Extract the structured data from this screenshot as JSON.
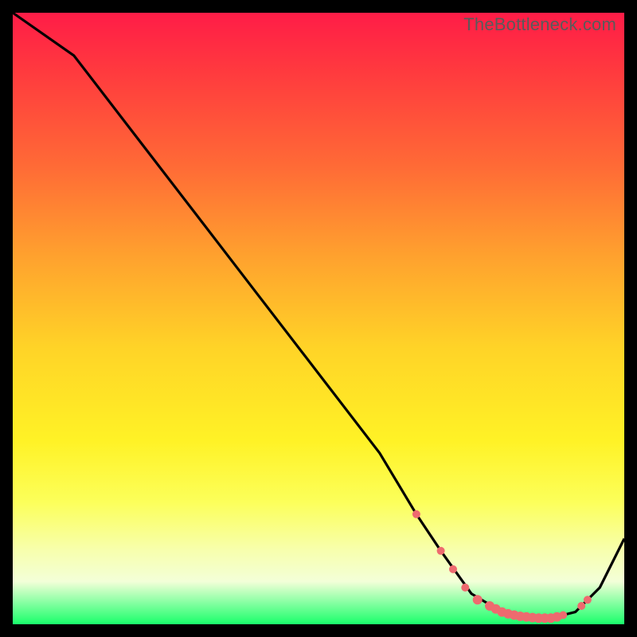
{
  "watermark": "TheBottleneck.com",
  "chart_data": {
    "type": "line",
    "title": "",
    "xlabel": "",
    "ylabel": "",
    "xlim": [
      0,
      100
    ],
    "ylim": [
      0,
      100
    ],
    "series": [
      {
        "name": "bottleneck-curve",
        "x": [
          0,
          10,
          20,
          30,
          40,
          50,
          60,
          66,
          70,
          75,
          80,
          85,
          88,
          92,
          96,
          100
        ],
        "y": [
          100,
          93,
          80,
          67,
          54,
          41,
          28,
          18,
          12,
          5,
          2,
          1,
          1,
          2,
          6,
          14
        ]
      }
    ],
    "markers": {
      "series": "bottleneck-curve",
      "color": "#ee6a6f",
      "points_x": [
        66,
        70,
        72,
        74,
        76,
        78,
        79,
        80,
        81,
        82,
        83,
        84,
        85,
        86,
        87,
        88,
        89,
        90,
        93,
        94
      ],
      "points_y": [
        18,
        12,
        9,
        6,
        4,
        3,
        2.5,
        2,
        1.7,
        1.5,
        1.3,
        1.2,
        1.1,
        1.0,
        1.0,
        1.0,
        1.2,
        1.5,
        3,
        4
      ]
    }
  }
}
